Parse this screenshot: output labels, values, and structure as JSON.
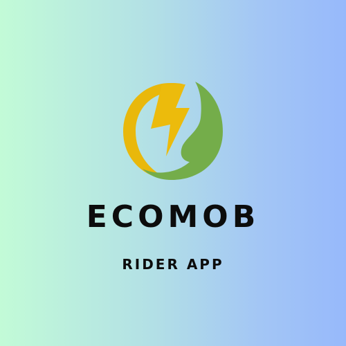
{
  "brand": {
    "name": "ECOMOB",
    "tagline": "RIDER APP"
  },
  "logo": {
    "icons": [
      "lightning-bolt-icon",
      "leaf-icon"
    ],
    "colors": {
      "ring_yellow": "#e9b80b",
      "bolt_yellow": "#ecbb0c",
      "leaf_green": "#74ad4a"
    }
  },
  "background": {
    "gradient_start": "#c2fbd7",
    "gradient_end": "#97b9fb"
  }
}
